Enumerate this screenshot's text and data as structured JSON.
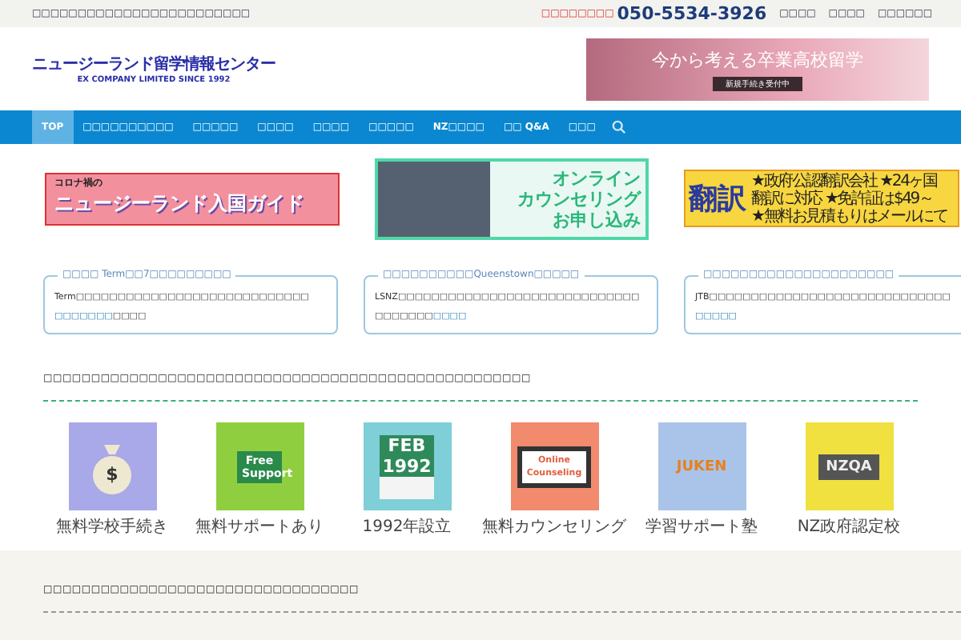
{
  "top_bar": {
    "tagline": "□□□□□□□□□□□□□□□□□□□□□□□□",
    "phone_label": "□□□□□□□□",
    "phone": "050-5534-3926",
    "links": [
      "□□□□",
      "□□□□",
      "□□□□□□"
    ]
  },
  "header": {
    "logo_title": "ニュージーランド留学情報センター",
    "logo_subtitle": "EX COMPANY LIMITED SINCE 1992",
    "banner_title": "今から考える卒業高校留学",
    "banner_button": "新規手続き受付中"
  },
  "nav": [
    {
      "label": "TOP",
      "selected": true
    },
    {
      "label": "□□□□□□□□□□",
      "selected": false
    },
    {
      "label": "□□□□□",
      "selected": false
    },
    {
      "label": "□□□□",
      "selected": false
    },
    {
      "label": "□□□□",
      "selected": false
    },
    {
      "label": "□□□□□",
      "selected": false
    },
    {
      "label": "NZ□□□□",
      "selected": false
    },
    {
      "label": "□□ Q&A",
      "selected": false
    },
    {
      "label": "□□□",
      "selected": false
    }
  ],
  "banners": [
    {
      "kind": "guide",
      "lines": [
        "コロナ禍の",
        "ニュージーランド入国ガイド"
      ]
    },
    {
      "kind": "counseling",
      "lines": [
        "オンライン",
        "カウンセリング",
        "お申し込み"
      ]
    },
    {
      "kind": "translation",
      "lines": [
        "翻訳",
        "★政府公認翻訳会社 ★24ヶ国",
        "翻訳に対応 ★免許証は$49～",
        "★無料お見積もりはメールにて"
      ]
    }
  ],
  "notices": [
    {
      "title": "□□□□ Term□□7□□□□□□□□□",
      "text": "Term□□□□□□□□□□□□□□□□□□□□□□□□□□□□",
      "link": "□□□□□□□",
      "text_after": "□□□□"
    },
    {
      "title": "□□□□□□□□□□Queenstown□□□□□",
      "text": "LSNZ□□□□□□□□□□□□□□□□□□□□□□□□□□□□□□□□□□□□",
      "link": "□□□□"
    },
    {
      "title": "□□□□□□□□□□□□□□□□□□□□□",
      "text": "JTB□□□□□□□□□□□□□□□□□□□□□□□□□□□□□",
      "link": "□□□□□"
    }
  ],
  "features_heading": "□□□□□□□□□□□□□□□□□□□□□□□□□□□□□□□□□□□□□□□□□□□□□□□□□□□",
  "features": [
    {
      "kind": "money",
      "label": "無料学校手続き",
      "tile_text": "$"
    },
    {
      "kind": "cup",
      "label": "無料サポートあり",
      "tile_text": "Free Support"
    },
    {
      "kind": "calendar",
      "label": "1992年設立",
      "tile_text": "FEB 1992"
    },
    {
      "kind": "monitor",
      "label": "無料カウンセリング",
      "tile_text": "Online Counseling"
    },
    {
      "kind": "pencil",
      "label": "学習サポート塾",
      "tile_text": "JUKEN"
    },
    {
      "kind": "cap",
      "label": "NZ政府認定校",
      "tile_text": "NZQA"
    }
  ],
  "bottom_heading": "□□□□□□□□□□□□□□□□□□□□□□□□□□□□□□□□□"
}
